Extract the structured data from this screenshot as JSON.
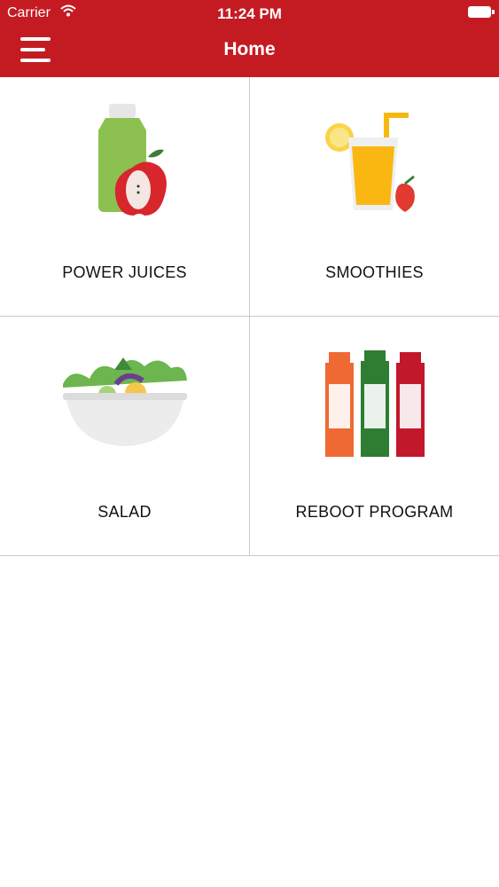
{
  "status_bar": {
    "carrier": "Carrier",
    "time": "11:24 PM"
  },
  "header": {
    "title": "Home",
    "menu_icon": "hamburger-menu-icon"
  },
  "tiles": [
    {
      "label": "POWER JUICES",
      "icon": "juice-bottle-apple-icon"
    },
    {
      "label": "SMOOTHIES",
      "icon": "smoothie-glass-icon"
    },
    {
      "label": "SALAD",
      "icon": "salad-bowl-icon"
    },
    {
      "label": "REBOOT PROGRAM",
      "icon": "juice-bottles-icon"
    }
  ],
  "colors": {
    "header_bg": "#c41b23",
    "divider": "#c9c9c9"
  }
}
